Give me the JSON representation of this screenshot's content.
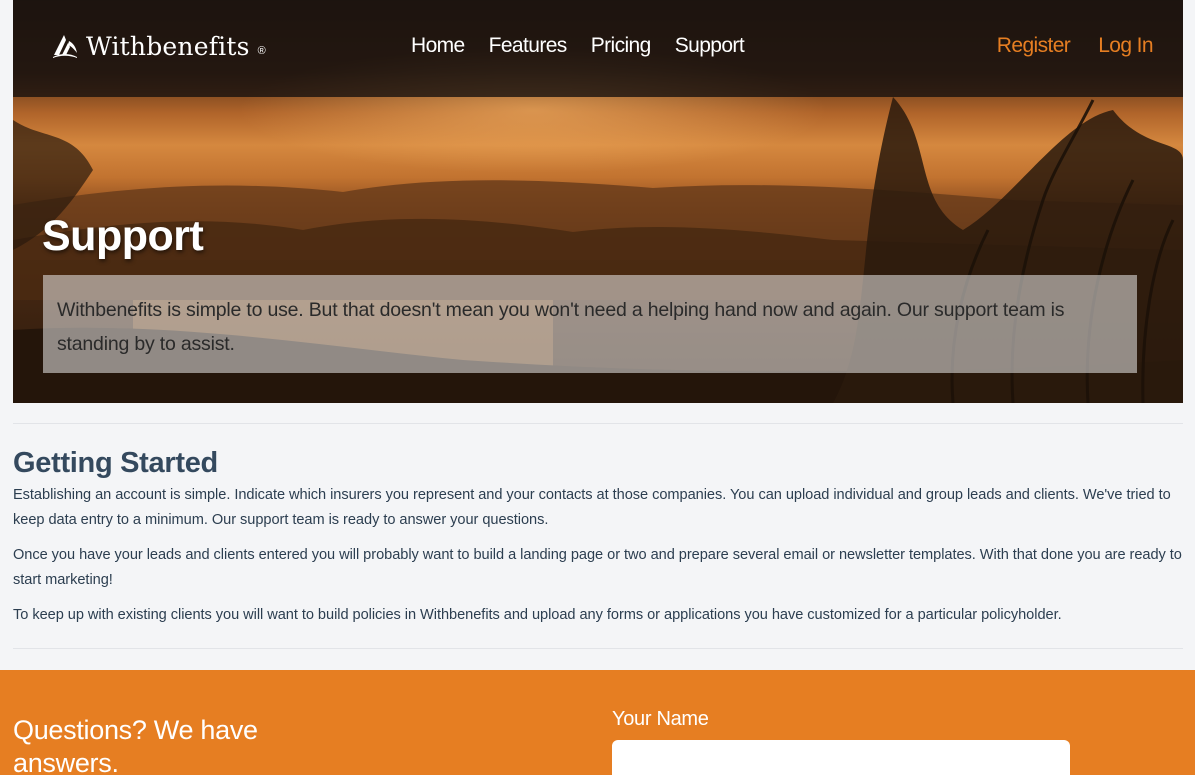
{
  "brand": {
    "name": "Withbenefits",
    "registered": "®"
  },
  "nav": {
    "links": [
      "Home",
      "Features",
      "Pricing",
      "Support"
    ],
    "register": "Register",
    "login": "Log In"
  },
  "hero": {
    "title": "Support",
    "lead": "Withbenefits is simple to use. But that doesn't mean you won't need a helping hand now and again. Our support team is standing by to assist."
  },
  "content": {
    "heading": "Getting Started",
    "paragraphs": [
      "Establishing an account is simple. Indicate which insurers you represent and your contacts at those companies. You can upload individual and group leads and clients. We've tried to keep data entry to a minimum. Our support team is ready to answer your questions.",
      "Once you have your leads and clients entered you will probably want to build a landing page or two and prepare several email or newsletter templates. With that done you are ready to start marketing!",
      "To keep up with existing clients you will want to build policies in Withbenefits and upload any forms or applications you have customized for a particular policyholder."
    ]
  },
  "contact": {
    "heading": "Questions? We have answers.",
    "name_label": "Your Name",
    "name_value": ""
  },
  "colors": {
    "accent": "#e67e22",
    "text": "#2c3e50",
    "heading": "#34495e"
  }
}
